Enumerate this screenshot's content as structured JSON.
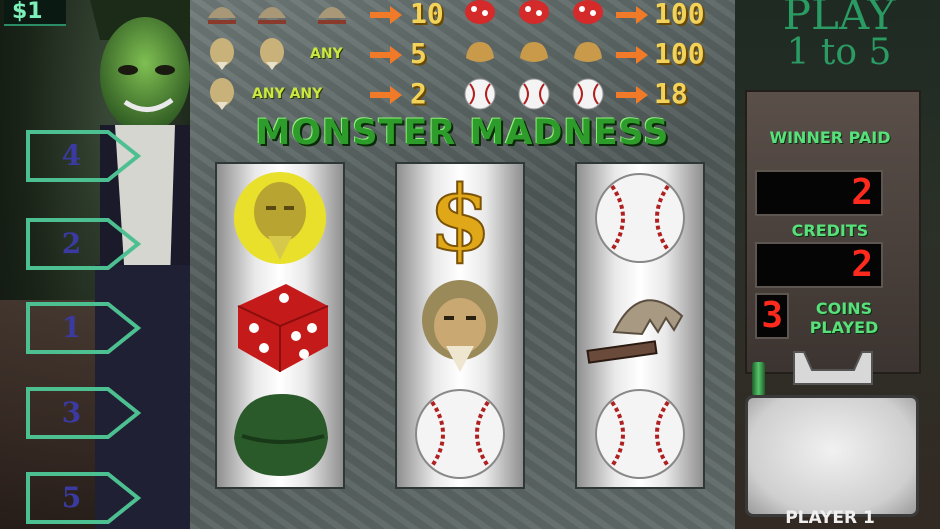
{
  "left_panel": {
    "coin_readout": "$1",
    "payline_numbers": [
      "4",
      "2",
      "1",
      "3",
      "5"
    ]
  },
  "paytable": {
    "rows": [
      {
        "left_symbols": [
          "trap-icon",
          "trap-icon",
          "trap-icon"
        ],
        "left_any": "",
        "left_payout": "10",
        "right_symbols": [
          "mushroom-icon",
          "mushroom-icon",
          "mushroom-icon"
        ],
        "right_payout": "100"
      },
      {
        "left_symbols": [
          "bigfoot-head-icon",
          "bigfoot-head-icon"
        ],
        "left_any": "ANY",
        "left_payout": "5",
        "right_symbols": [
          "bread-icon",
          "bread-icon",
          "bread-icon"
        ],
        "right_payout": "100"
      },
      {
        "left_symbols": [
          "bigfoot-head-icon"
        ],
        "left_any": "ANY ANY",
        "left_payout": "2",
        "right_symbols": [
          "baseball-icon",
          "baseball-icon",
          "baseball-icon"
        ],
        "right_payout": "18"
      }
    ]
  },
  "machine": {
    "title": "MONSTER MADNESS",
    "reels": [
      [
        "bigfoot-coin-icon",
        "red-die-icon",
        "green-helmet-icon"
      ],
      [
        "dollar-sign-icon",
        "bigfoot-head-icon",
        "baseball-icon"
      ],
      [
        "baseball-icon",
        "bear-trap-icon",
        "baseball-icon"
      ]
    ]
  },
  "right_panel": {
    "play_sign_line1": "PLAY",
    "play_sign_line2": "1 to 5",
    "winner_paid_label": "WINNER PAID",
    "winner_paid_value": "2",
    "credits_label": "CREDITS",
    "credits_value": "2",
    "coins_played_value": "3",
    "coins_played_label": "COINS PLAYED",
    "player_label": "PLAYER 1"
  },
  "colors": {
    "title_green": "#2d9c2a",
    "payout_gold": "#f3d25a",
    "lcd_red": "#ff2a1e",
    "label_green": "#58e07a"
  }
}
